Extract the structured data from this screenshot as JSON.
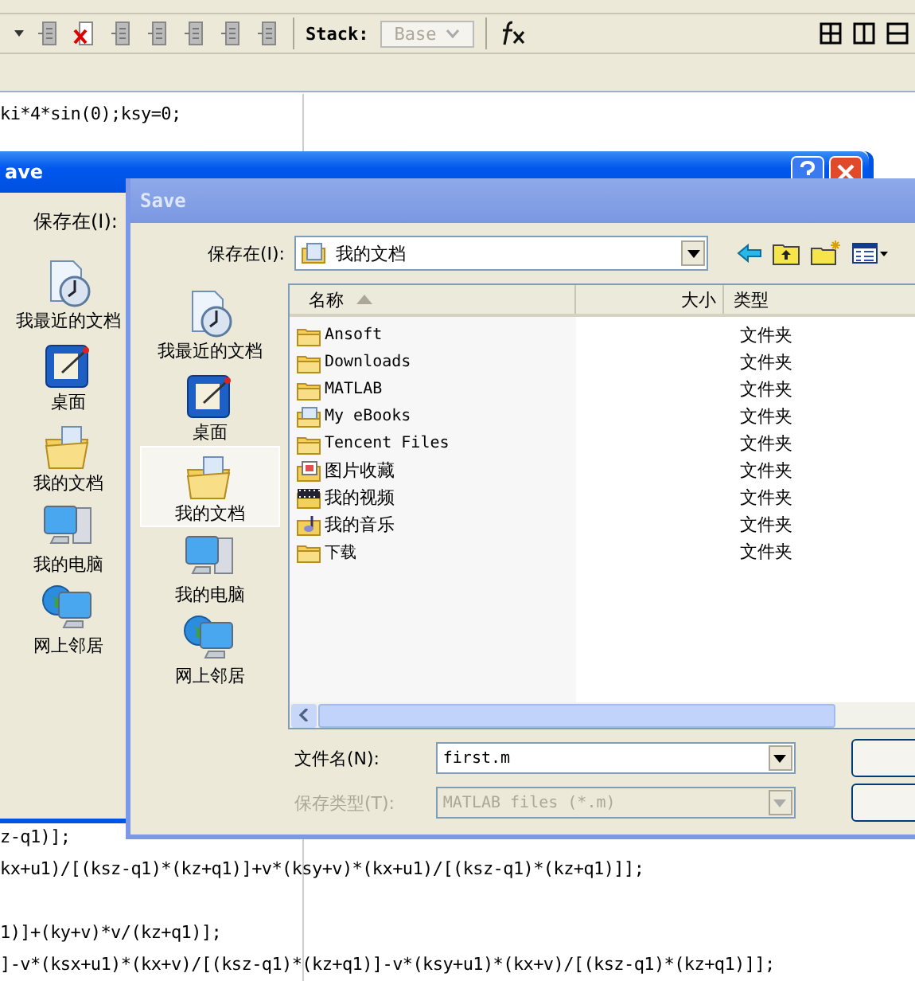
{
  "toolbar": {
    "stack_label": "Stack:",
    "stack_value": "Base",
    "stack_disabled": true
  },
  "editor": {
    "top_lines": [
      "ki*4*sin(0);ksy=0;"
    ],
    "bottom_blocks": [
      [
        "z-q1)];",
        "kx+u1)/[(ksz-q1)*(kz+q1)]+v*(ksy+v)*(kx+u1)/[(ksz-q1)*(kz+q1)]];"
      ],
      [
        "1)]+(ky+v)*v/(kz+q1)];",
        "]-v*(ksx+u1)*(kx+v)/[(ksz-q1)*(kz+q1)]-v*(ksy+u1)*(kx+v)/[(ksz-q1)*(kz+q1)]];"
      ]
    ]
  },
  "back_dialog": {
    "title": "ave",
    "save_in_label": "保存在(I):",
    "places": [
      {
        "kind": "recent",
        "label": "我最近的文档"
      },
      {
        "kind": "desktop",
        "label": "桌面"
      },
      {
        "kind": "documents",
        "label": "我的文档"
      },
      {
        "kind": "computer",
        "label": "我的电脑"
      },
      {
        "kind": "network",
        "label": "网上邻居"
      }
    ]
  },
  "save_dialog": {
    "title": "Save",
    "save_in_label": "保存在(I):",
    "location": "我的文档",
    "places": [
      {
        "kind": "recent",
        "label": "我最近的文档",
        "selected": false
      },
      {
        "kind": "desktop",
        "label": "桌面",
        "selected": false
      },
      {
        "kind": "documents",
        "label": "我的文档",
        "selected": true
      },
      {
        "kind": "computer",
        "label": "我的电脑",
        "selected": false
      },
      {
        "kind": "network",
        "label": "网上邻居",
        "selected": false
      }
    ],
    "columns": [
      "名称",
      "大小",
      "类型"
    ],
    "files": [
      {
        "kind": "folder",
        "name": "Ansoft",
        "type": "文件夹"
      },
      {
        "kind": "folder",
        "name": "Downloads",
        "type": "文件夹"
      },
      {
        "kind": "folder",
        "name": "MATLAB",
        "type": "文件夹"
      },
      {
        "kind": "documents",
        "name": "My eBooks",
        "type": "文件夹"
      },
      {
        "kind": "folder",
        "name": "Tencent Files",
        "type": "文件夹"
      },
      {
        "kind": "pictures",
        "name": "图片收藏",
        "type": "文件夹"
      },
      {
        "kind": "videos",
        "name": "我的视频",
        "type": "文件夹"
      },
      {
        "kind": "music",
        "name": "我的音乐",
        "type": "文件夹"
      },
      {
        "kind": "folder",
        "name": "下载",
        "type": "文件夹"
      }
    ],
    "filename_label": "文件名(N):",
    "filename": "first.m",
    "filetype_label": "保存类型(T):",
    "filetype": "MATLAB files (*.m)",
    "filetype_disabled": true
  }
}
